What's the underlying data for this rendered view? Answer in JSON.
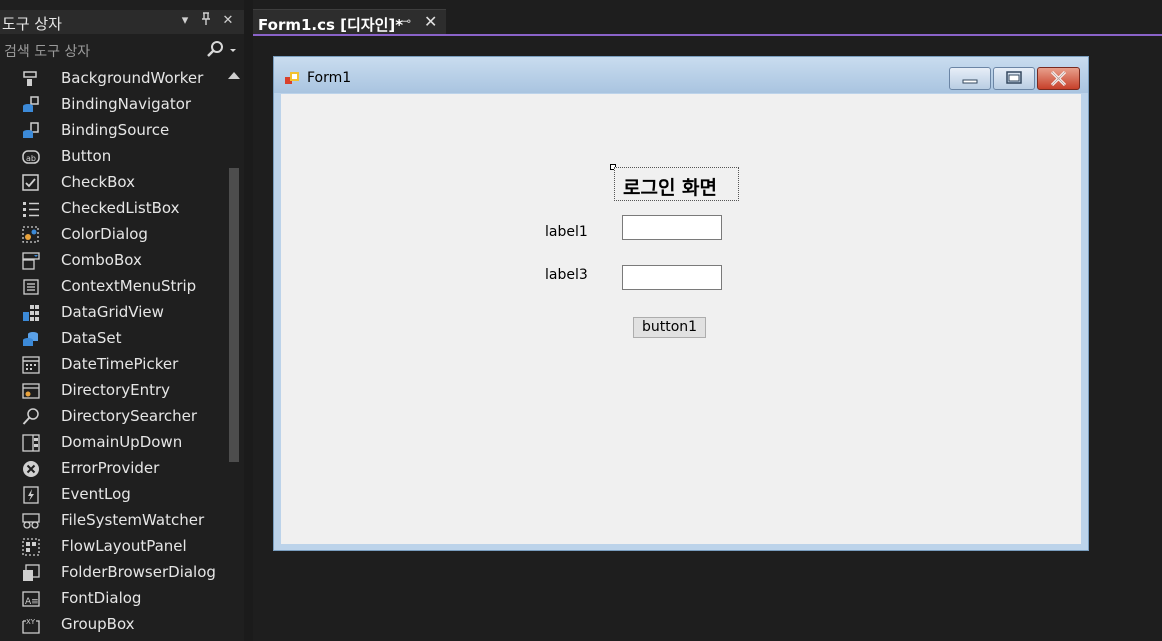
{
  "toolbox": {
    "title": "도구 상자",
    "search_placeholder": "검색 도구 상자",
    "items": [
      {
        "label": "BackgroundWorker",
        "icon": "background-worker-icon"
      },
      {
        "label": "BindingNavigator",
        "icon": "binding-navigator-icon"
      },
      {
        "label": "BindingSource",
        "icon": "binding-source-icon"
      },
      {
        "label": "Button",
        "icon": "button-icon"
      },
      {
        "label": "CheckBox",
        "icon": "checkbox-icon"
      },
      {
        "label": "CheckedListBox",
        "icon": "checked-listbox-icon"
      },
      {
        "label": "ColorDialog",
        "icon": "color-dialog-icon"
      },
      {
        "label": "ComboBox",
        "icon": "combobox-icon"
      },
      {
        "label": "ContextMenuStrip",
        "icon": "context-menu-icon"
      },
      {
        "label": "DataGridView",
        "icon": "datagridview-icon"
      },
      {
        "label": "DataSet",
        "icon": "dataset-icon"
      },
      {
        "label": "DateTimePicker",
        "icon": "datetimepicker-icon"
      },
      {
        "label": "DirectoryEntry",
        "icon": "directory-entry-icon"
      },
      {
        "label": "DirectorySearcher",
        "icon": "directory-searcher-icon"
      },
      {
        "label": "DomainUpDown",
        "icon": "domain-updown-icon"
      },
      {
        "label": "ErrorProvider",
        "icon": "error-provider-icon"
      },
      {
        "label": "EventLog",
        "icon": "eventlog-icon"
      },
      {
        "label": "FileSystemWatcher",
        "icon": "filesystemwatcher-icon"
      },
      {
        "label": "FlowLayoutPanel",
        "icon": "flowlayoutpanel-icon"
      },
      {
        "label": "FolderBrowserDialog",
        "icon": "folder-browser-icon"
      },
      {
        "label": "FontDialog",
        "icon": "font-dialog-icon"
      },
      {
        "label": "GroupBox",
        "icon": "groupbox-icon"
      }
    ]
  },
  "tab": {
    "label": "Form1.cs [디자인]*",
    "pin_glyph": "⊸",
    "close_glyph": "✕"
  },
  "form": {
    "title": "Form1",
    "heading": "로그인 화면",
    "label1": "label1",
    "label3": "label3",
    "button1": "button1"
  },
  "colors": {
    "accent": "#8a63c9",
    "panel_bg": "#1f1f1f",
    "form_client": "#f0f0f0"
  }
}
